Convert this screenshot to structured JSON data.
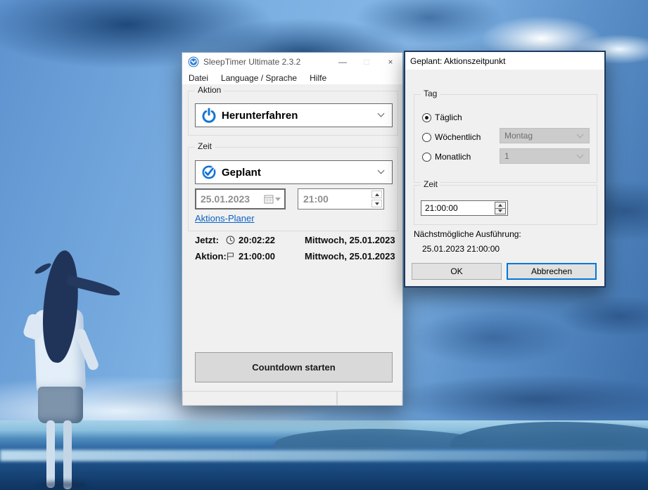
{
  "colors": {
    "accent_blue": "#1574d4",
    "focus_blue": "#0078d7",
    "link_blue": "#0a62c5",
    "window_bg": "#f0f0f0",
    "titlebar_bg": "#ffffff",
    "disabled_combo_bg": "#cccccc",
    "dialog_border": "#1d3a5f"
  },
  "main_window": {
    "title": "SleepTimer Ultimate 2.3.2",
    "controls": {
      "minimize": "—",
      "maximize": "□",
      "close": "×"
    },
    "menu": [
      "Datei",
      "Language / Sprache",
      "Hilfe"
    ],
    "action_group": {
      "label": "Aktion",
      "combo_value": "Herunterfahren",
      "icon": "power-icon"
    },
    "time_group": {
      "label": "Zeit",
      "combo_value": "Geplant",
      "icon": "check-circle-icon",
      "date_value": "25.01.2023",
      "time_value": "21:00",
      "link_label": "Aktions-Planer"
    },
    "now_row": {
      "label": "Jetzt:",
      "icon": "clock-icon",
      "time": "20:02:22",
      "date": "Mittwoch, 25.01.2023"
    },
    "action_row": {
      "label": "Aktion:",
      "icon": "flag-icon",
      "time": "21:00:00",
      "date": "Mittwoch, 25.01.2023"
    },
    "start_button_label": "Countdown starten"
  },
  "dialog": {
    "title": "Geplant: Aktionszeitpunkt",
    "day_group": {
      "label": "Tag",
      "radios": [
        {
          "label": "Täglich",
          "selected": true
        },
        {
          "label": "Wöchentlich",
          "selected": false,
          "combo": "Montag"
        },
        {
          "label": "Monatlich",
          "selected": false,
          "combo": "1"
        }
      ]
    },
    "time_group": {
      "label": "Zeit",
      "value": "21:00:00"
    },
    "next_execution": {
      "label": "Nächstmögliche Ausführung:",
      "value": "25.01.2023 21:00:00"
    },
    "buttons": {
      "ok": "OK",
      "cancel": "Abbrechen"
    }
  }
}
